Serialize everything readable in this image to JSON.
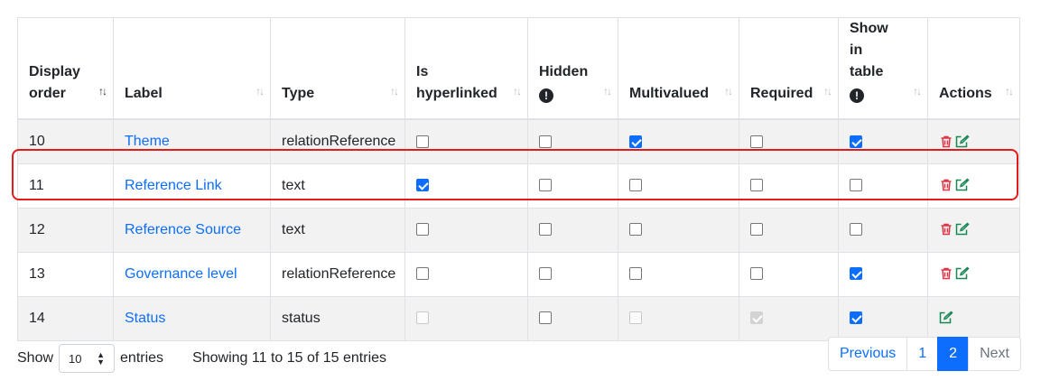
{
  "columns": [
    {
      "label": "Display order",
      "sort": "↑↓"
    },
    {
      "label": "Label",
      "sort": "↑↓"
    },
    {
      "label": "Type",
      "sort": "↑↓"
    },
    {
      "label": "Is hyperlinked",
      "sort": "↑↓"
    },
    {
      "label": "Hidden",
      "sort": "↑↓"
    },
    {
      "label": "Multivalued",
      "sort": "↑↓"
    },
    {
      "label": "Required",
      "sort": "↑↓"
    },
    {
      "label": "Show in table",
      "sort": "↑↓"
    },
    {
      "label": "Actions",
      "sort": "↑↓"
    }
  ],
  "rows": [
    {
      "order": "10",
      "label": "Theme",
      "type": "relationReference",
      "is_hyperlinked": false,
      "hidden": false,
      "multivalued": true,
      "required": false,
      "show_in_table": true,
      "deletable": true
    },
    {
      "order": "11",
      "label": "Reference Link",
      "type": "text",
      "is_hyperlinked": true,
      "hidden": false,
      "multivalued": false,
      "required": false,
      "show_in_table": false,
      "deletable": true
    },
    {
      "order": "12",
      "label": "Reference Source",
      "type": "text",
      "is_hyperlinked": false,
      "hidden": false,
      "multivalued": false,
      "required": false,
      "show_in_table": false,
      "deletable": true
    },
    {
      "order": "13",
      "label": "Governance level",
      "type": "relationReference",
      "is_hyperlinked": false,
      "hidden": false,
      "multivalued": false,
      "required": false,
      "show_in_table": true,
      "deletable": true
    },
    {
      "order": "14",
      "label": "Status",
      "type": "status",
      "is_hyperlinked": false,
      "hidden": false,
      "multivalued": false,
      "required": true,
      "show_in_table": true,
      "deletable": false
    }
  ],
  "footer": {
    "show_label": "Show",
    "page_size": "10",
    "entries_label": "entries",
    "info": "Showing 11 to 15 of 15 entries"
  },
  "pagination": {
    "previous": "Previous",
    "pages": [
      "1",
      "2"
    ],
    "current": "2",
    "next": "Next"
  },
  "colors": {
    "link": "#0d6efd",
    "checked": "#0d6efd",
    "delete_icon": "#dc3545",
    "edit_icon": "#198754",
    "highlight": "#e21b1b"
  },
  "icons": {
    "delete": "trash-icon",
    "edit": "edit-icon",
    "info": "info-circle-icon"
  }
}
